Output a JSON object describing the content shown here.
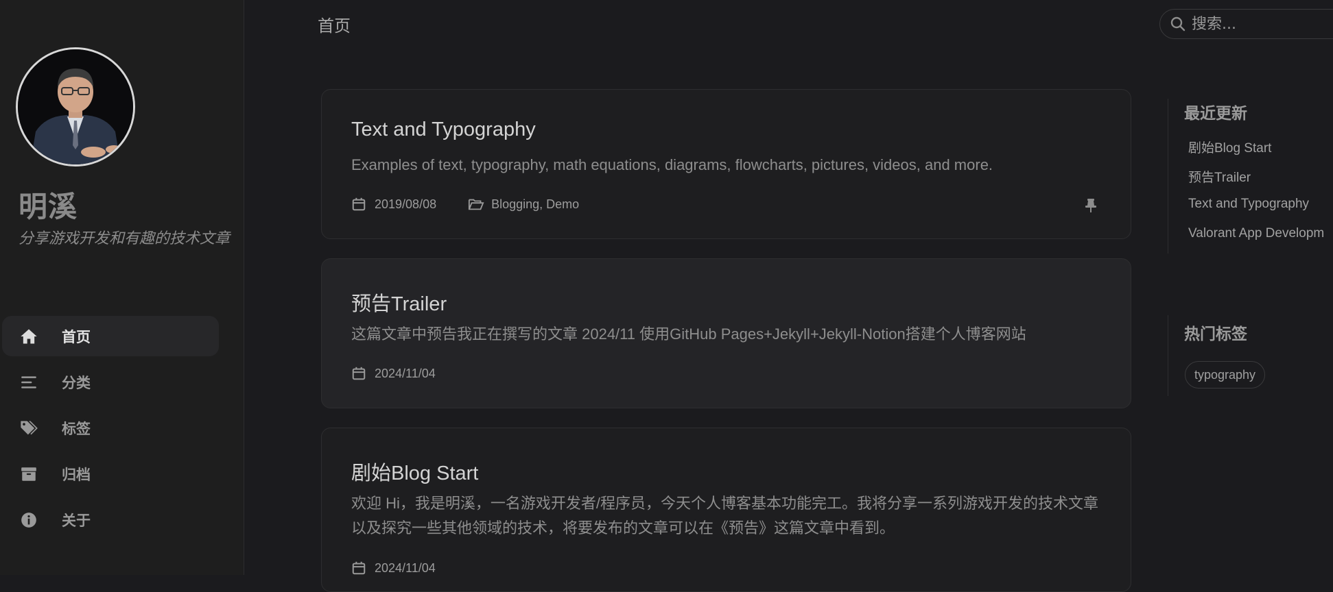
{
  "sidebar": {
    "site_title": "明溪",
    "site_subtitle": "分享游戏开发和有趣的技术文章",
    "nav": [
      {
        "label": "首页",
        "icon": "home-icon",
        "active": true
      },
      {
        "label": "分类",
        "icon": "list-icon",
        "active": false
      },
      {
        "label": "标签",
        "icon": "tags-icon",
        "active": false
      },
      {
        "label": "归档",
        "icon": "archive-icon",
        "active": false
      },
      {
        "label": "关于",
        "icon": "info-icon",
        "active": false
      }
    ]
  },
  "topbar": {
    "breadcrumb": "首页",
    "search_placeholder": "搜索..."
  },
  "posts": [
    {
      "title": "Text and Typography",
      "excerpt": "Examples of text, typography, math equations, diagrams, flowcharts, pictures, videos, and more.",
      "date": "2019/08/08",
      "categories": "Blogging, Demo",
      "pinned": true
    },
    {
      "title": "预告Trailer",
      "excerpt": "这篇文章中预告我正在撰写的文章 2024/11 使用GitHub Pages+Jekyll+Jekyll-Notion搭建个人博客网站",
      "date": "2024/11/04",
      "pinned": false
    },
    {
      "title": "剧始Blog Start",
      "excerpt": "欢迎 Hi，我是明溪，一名游戏开发者/程序员，今天个人博客基本功能完工。我将分享一系列游戏开发的技术文章以及探究一些其他领域的技术，将要发布的文章可以在《预告》这篇文章中看到。",
      "date": "2024/11/04",
      "pinned": false
    }
  ],
  "panel": {
    "recent_heading": "最近更新",
    "recent": [
      "剧始Blog Start",
      "预告Trailer",
      "Text and Typography",
      "Valorant App Developm"
    ],
    "tags_heading": "热门标签",
    "tags": [
      "typography"
    ]
  },
  "colors": {
    "background": "#1b1b1e",
    "sidebar": "#1e1e1e",
    "card": "#1e1e20",
    "card_alt": "#242427"
  }
}
